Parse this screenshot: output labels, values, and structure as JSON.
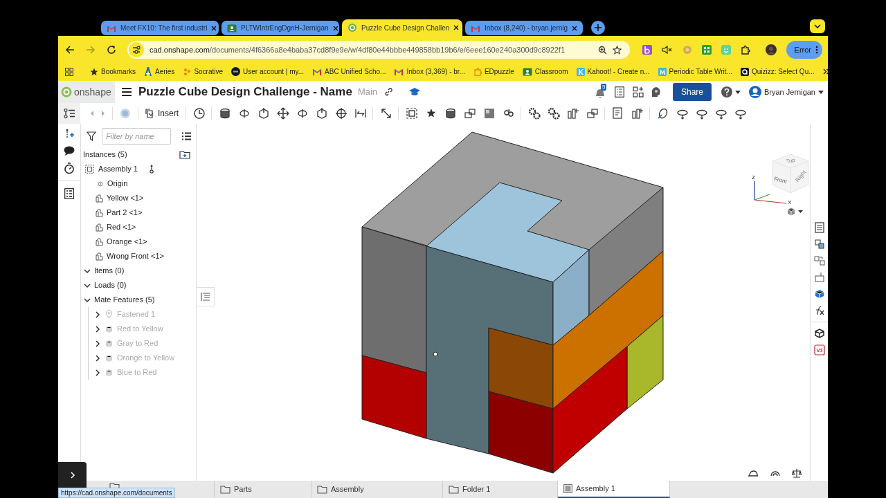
{
  "browser_tabs": [
    {
      "title": "Meet FX10: The first industri",
      "selected": false,
      "kind": "mail"
    },
    {
      "title": "PLTWIntrEngDgnH-Jernigan",
      "selected": false,
      "kind": "classroom"
    },
    {
      "title": "Puzzle Cube Design Challen",
      "selected": true,
      "kind": "onshape"
    },
    {
      "title": "Inbox (8,240) - bryan.jernig",
      "selected": false,
      "kind": "mail"
    }
  ],
  "address_bar": {
    "domain": "cad.onshape.com",
    "path": "/documents/4f6366a8e4baba37cd8f9e9e/w/4df80e44bbbe449858bb19b6/e/6eee160e240a300d9c8922f1"
  },
  "profile_button": "Error",
  "bookmarks": [
    {
      "label": "Bookmarks",
      "kind": "star"
    },
    {
      "label": "Aeries",
      "kind": "letter-a"
    },
    {
      "label": "Socrative",
      "kind": "dots"
    },
    {
      "label": "User account | my...",
      "kind": "dark-circle"
    },
    {
      "label": "ABC Unified Scho...",
      "kind": "mail"
    },
    {
      "label": "Inbox (3,369) - br...",
      "kind": "mail"
    },
    {
      "label": "EDpuzzle",
      "kind": "puzzle"
    },
    {
      "label": "Classroom",
      "kind": "classroom"
    },
    {
      "label": "Kahoot! - Create n...",
      "kind": "k-square"
    },
    {
      "label": "Periodic Table Writ...",
      "kind": "m-square"
    },
    {
      "label": "Quizizz: Select Qu...",
      "kind": "q-square"
    }
  ],
  "header": {
    "logo": "onshape",
    "title": "Puzzle Cube Design Challenge - Name",
    "branch": "Main",
    "notification_count": "5",
    "share": "Share",
    "user": "Bryan Jernigan"
  },
  "toolbar": {
    "insert": "Insert"
  },
  "filter": {
    "placeholder": "Filter by name"
  },
  "tree": {
    "heading": "Instances (5)",
    "items": [
      {
        "label": "Assembly 1",
        "kind": "assembly",
        "children": [
          {
            "label": "Origin",
            "kind": "origin"
          },
          {
            "label": "Yellow <1>",
            "kind": "part"
          },
          {
            "label": "Part 2 <1>",
            "kind": "part"
          },
          {
            "label": "Red <1>",
            "kind": "part"
          },
          {
            "label": "Orange <1>",
            "kind": "part"
          },
          {
            "label": "Wrong Front <1>",
            "kind": "part"
          }
        ]
      }
    ]
  },
  "sections": [
    {
      "label": "Items (0)",
      "expanded": true
    },
    {
      "label": "Loads (0)",
      "expanded": true
    },
    {
      "label": "Mate Features (5)",
      "expanded": true,
      "children": [
        {
          "label": "Fastened 1",
          "kind": "fastened",
          "suppressed": true,
          "expanded": false
        },
        {
          "label": "Red to Yellow",
          "kind": "mate",
          "suppressed": true,
          "expanded": false
        },
        {
          "label": "Gray to Red",
          "kind": "mate",
          "suppressed": true,
          "expanded": false
        },
        {
          "label": "Orange to Yellow",
          "kind": "mate",
          "suppressed": true,
          "expanded": false
        },
        {
          "label": "Blue to Red",
          "kind": "mate",
          "suppressed": true,
          "expanded": false
        }
      ]
    }
  ],
  "view_cube": {
    "axis_z": "Z",
    "axis_x": "X",
    "front": "Front",
    "top": "Top",
    "right": "Right"
  },
  "bottom_tabs": [
    {
      "kind": "folder",
      "selected": false
    },
    {
      "label": "Parts",
      "kind": "folder",
      "selected": false
    },
    {
      "label": "Assembly",
      "kind": "folder",
      "selected": false
    },
    {
      "label": "Folder 1",
      "kind": "folder",
      "selected": false
    },
    {
      "label": "Assembly 1",
      "kind": "assembly",
      "selected": true
    }
  ],
  "status_url": "https://cad.onshape.com/documents"
}
